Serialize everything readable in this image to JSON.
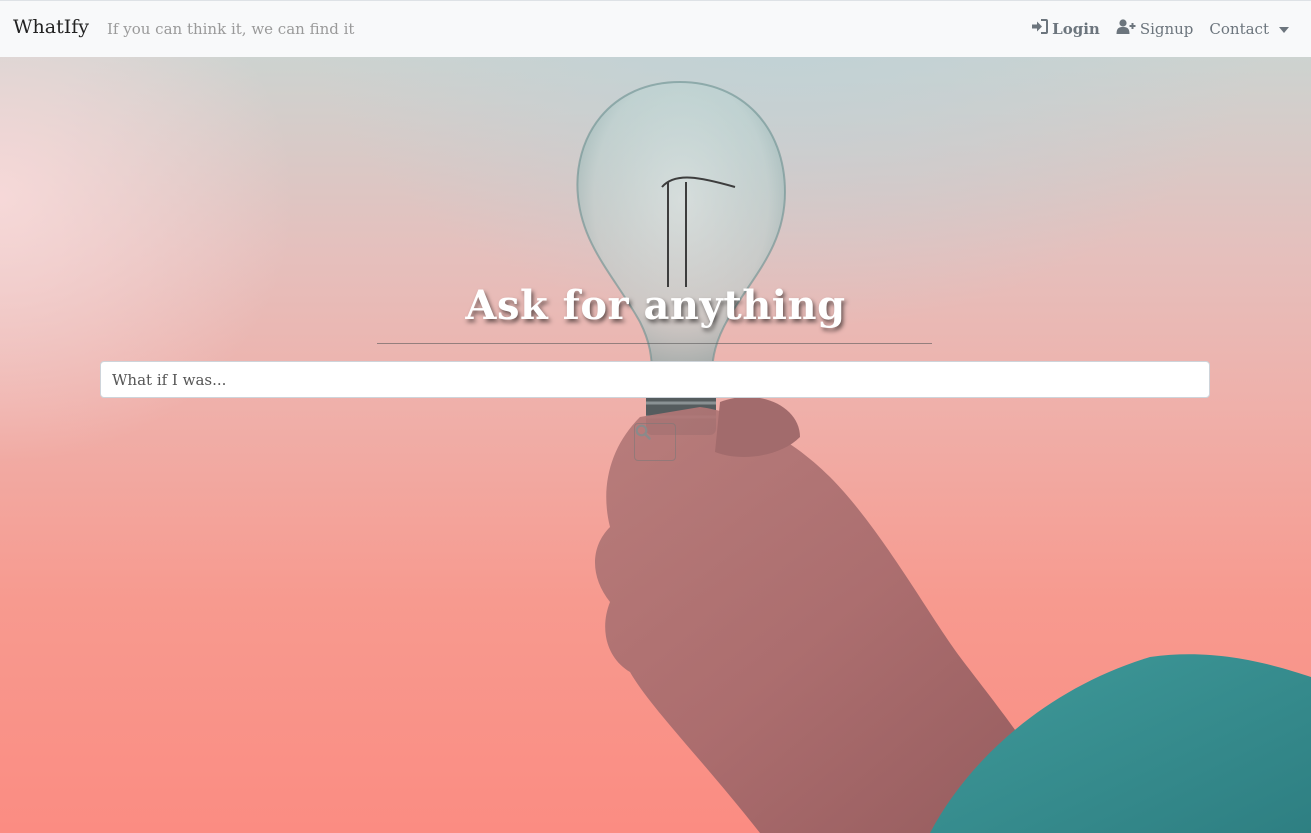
{
  "navbar": {
    "brand": "WhatIfy",
    "tagline": "If you can think it, we can find it",
    "login_label": "Login",
    "signup_label": "Signup",
    "contact_label": "Contact"
  },
  "hero": {
    "title": "Ask for anything",
    "search_placeholder": "What if I was..."
  },
  "icons": {
    "login": "sign-in-icon",
    "signup": "user-plus-icon",
    "search": "search-icon"
  },
  "colors": {
    "navbar_bg": "#f8f9fa",
    "muted_text": "#6c757d",
    "title_text": "#ffffff"
  }
}
